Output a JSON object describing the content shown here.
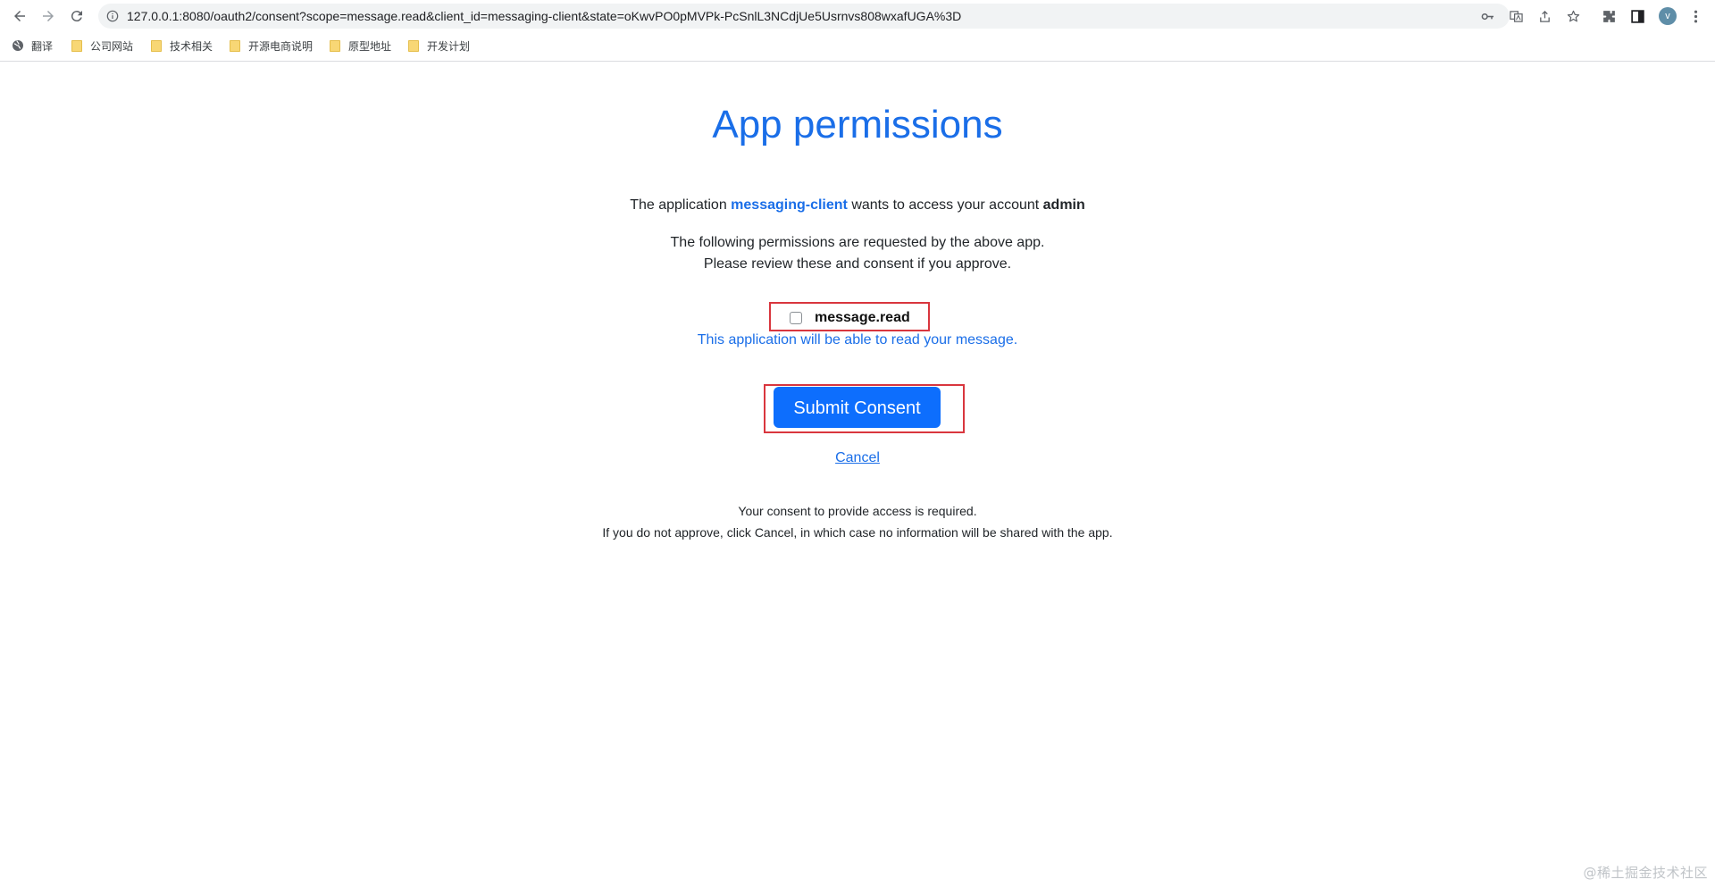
{
  "browser": {
    "url": "127.0.0.1:8080/oauth2/consent?scope=message.read&client_id=messaging-client&state=oKwvPO0pMVPk-PcSnlL3NCdjUe5Usrnvs808wxafUGA%3D",
    "avatar_initial": "v",
    "bookmarks": [
      {
        "label": "翻译",
        "icon": "globe-icon"
      },
      {
        "label": "公司网站",
        "icon": "folder-icon"
      },
      {
        "label": "技术相关",
        "icon": "folder-icon"
      },
      {
        "label": "开源电商说明",
        "icon": "folder-icon"
      },
      {
        "label": "原型地址",
        "icon": "folder-icon"
      },
      {
        "label": "开发计划",
        "icon": "folder-icon"
      }
    ]
  },
  "page": {
    "title": "App permissions",
    "intro_prefix": "The application ",
    "client_name": "messaging-client",
    "intro_middle": " wants to access your account ",
    "account_name": "admin",
    "perm_line1": "The following permissions are requested by the above app.",
    "perm_line2": "Please review these and consent if you approve.",
    "scope": {
      "label": "message.read",
      "checked": false,
      "description": "This application will be able to read your message."
    },
    "submit_label": "Submit Consent",
    "cancel_label": "Cancel",
    "footnote_line1": "Your consent to provide access is required.",
    "footnote_line2": "If you do not approve, click Cancel, in which case no information will be shared with the app."
  },
  "watermark": "@稀土掘金技术社区",
  "colors": {
    "accent": "#1a6ee8",
    "button": "#0d6efd",
    "highlight_box": "#d9363e"
  }
}
